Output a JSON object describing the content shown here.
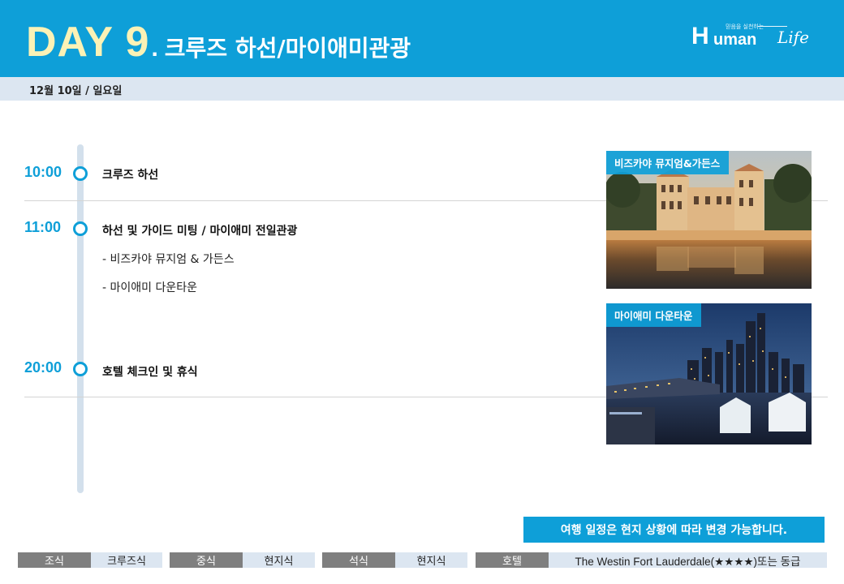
{
  "header": {
    "day": "DAY 9",
    "dot": ".",
    "title": "크루즈 하선/마이애미관광",
    "logo": {
      "slogan": "믿음을 실천하는",
      "h": "H",
      "human": "uman",
      "life": "Life"
    }
  },
  "date": "12월 10일 / 일요일",
  "schedule": [
    {
      "time": "10:00",
      "event": "크루즈 하선",
      "subs": []
    },
    {
      "time": "11:00",
      "event": "하선 및  가이드 미팅 / 마이애미 전일관광",
      "subs": [
        "- 비즈카야 뮤지엄 & 가든스",
        "- 마이애미 다운타운"
      ]
    },
    {
      "time": "20:00",
      "event": "호텔 체크인 및 휴식",
      "subs": []
    }
  ],
  "photos": [
    {
      "label": "비즈카야 뮤지엄&가든스"
    },
    {
      "label": "마이애미 다운타운"
    }
  ],
  "notice": "여행 일정은 현지 상황에 따라 변경 가능합니다.",
  "meals": [
    {
      "label": "조식",
      "value": "크루즈식"
    },
    {
      "label": "중식",
      "value": "현지식"
    },
    {
      "label": "석식",
      "value": "현지식"
    }
  ],
  "hotel": {
    "label": "호텔",
    "value": "The Westin Fort Lauderdale(★★★★)또는 동급"
  },
  "colors": {
    "primary": "#0e9fd8",
    "day_text": "#fbf2b6",
    "date_bar": "#dce6f1",
    "meal_label": "#7f7f7f",
    "timeline": "#d3e0ec"
  }
}
